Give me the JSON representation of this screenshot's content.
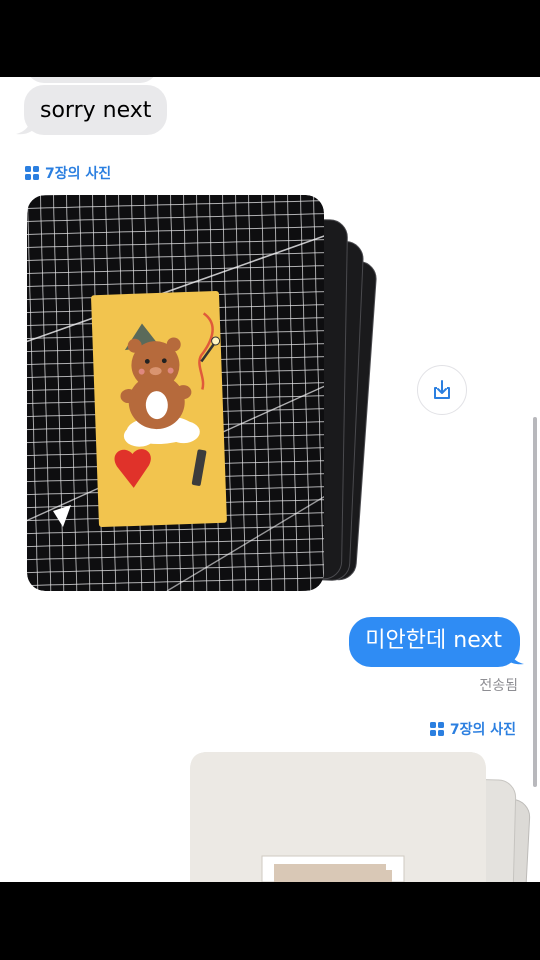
{
  "messages": {
    "received_1": "sorry next",
    "sent_1": "미안한데 next",
    "sent_status": "전송됨"
  },
  "photo_stacks": [
    {
      "label": "7장의 사진"
    },
    {
      "label": "7장의 사진"
    }
  ],
  "colors": {
    "accent": "#2b7fe0",
    "sent_bubble": "#2f8cf4",
    "received_bubble": "#e9e9eb"
  },
  "icons": {
    "stack": "photo-grid-icon",
    "download": "download-icon"
  }
}
